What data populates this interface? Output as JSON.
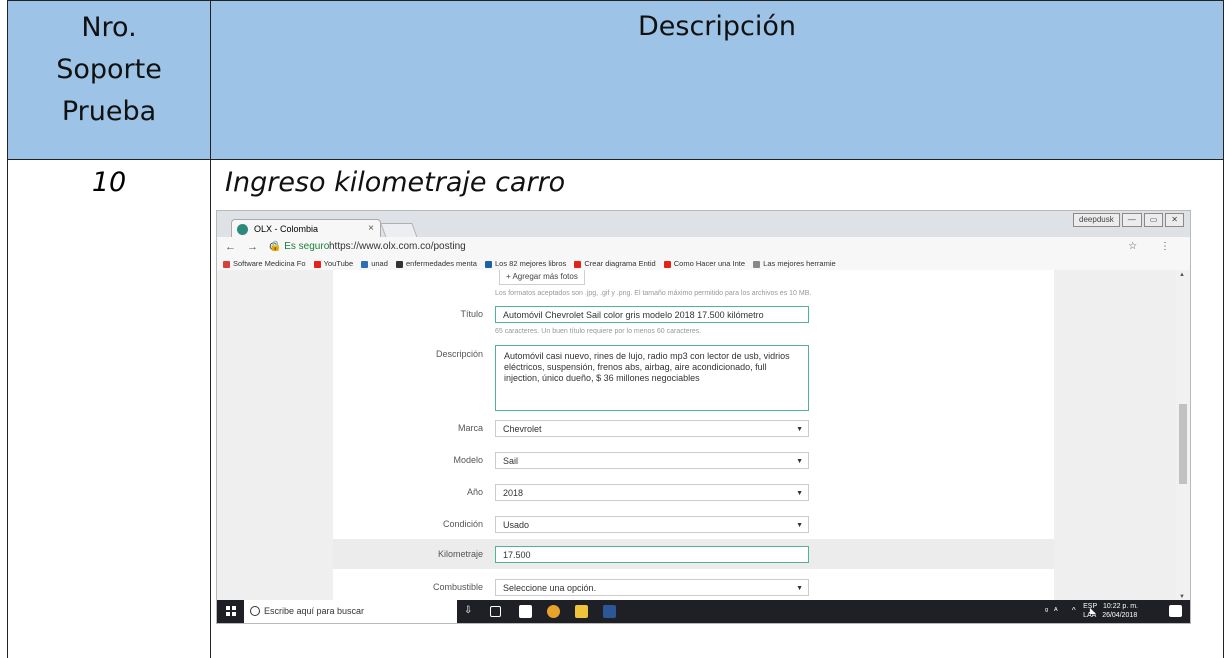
{
  "table": {
    "header": {
      "col1": [
        "Nro.",
        "Soporte",
        "Prueba"
      ],
      "col2": "Descripción"
    },
    "row": {
      "number": "10",
      "title": "Ingreso kilometraje carro"
    }
  },
  "browser": {
    "tab_title": "OLX - Colombia",
    "tab_close": "×",
    "window_controls": [
      "deepdusk",
      "—",
      "▭",
      "✕"
    ],
    "nav": "← → C",
    "secure_label": "Es seguro",
    "url": "https://www.olx.com.co/posting",
    "addr_icons": "☆ ⋮",
    "bookmarks": [
      {
        "label": "Software Medicina Fo",
        "color": "#d6413b"
      },
      {
        "label": "YouTube",
        "color": "#e62117"
      },
      {
        "label": "unad",
        "color": "#2e6eb3"
      },
      {
        "label": "enfermedades menta",
        "color": "#333333"
      },
      {
        "label": "Los 82 mejores libros",
        "color": "#1f5fa8"
      },
      {
        "label": "Crear diagrama Entid",
        "color": "#e62117"
      },
      {
        "label": "Como Hacer una Inte",
        "color": "#e62117"
      },
      {
        "label": "Las mejores herramie",
        "color": "#888888"
      }
    ]
  },
  "form": {
    "add_photos": "+ Agregar más fotos",
    "formats_hint": "Los formatos aceptados son .jpg, .gif y .png. El tamaño máximo permitido para los archivos es 10 MB.",
    "titulo_label": "Título",
    "titulo_value": "Automóvil Chevrolet Sail color gris modelo 2018 17.500 kilómetro",
    "titulo_hint": "65 caracteres. Un buen título requiere por lo menos 60 caracteres.",
    "descripcion_label": "Descripción",
    "descripcion_value": "Automóvil casi nuevo, rines de lujo, radio mp3 con lector de usb, vidrios eléctricos, suspensión, frenos abs, airbag, aire acondicionado, full injection, único dueño, $ 36 millones negociables",
    "marca_label": "Marca",
    "marca_value": "Chevrolet",
    "modelo_label": "Modelo",
    "modelo_value": "Sail",
    "anio_label": "Año",
    "anio_value": "2018",
    "condicion_label": "Condición",
    "condicion_value": "Usado",
    "km_label": "Kilometraje",
    "km_value": "17.500",
    "combustible_label": "Combustible",
    "combustible_value": "Seleccione una opción."
  },
  "taskbar": {
    "search_placeholder": "Escribe aquí para buscar",
    "lang": "ESP",
    "layout": "LAA",
    "time": "10:22 p. m.",
    "date": "26/04/2018"
  }
}
